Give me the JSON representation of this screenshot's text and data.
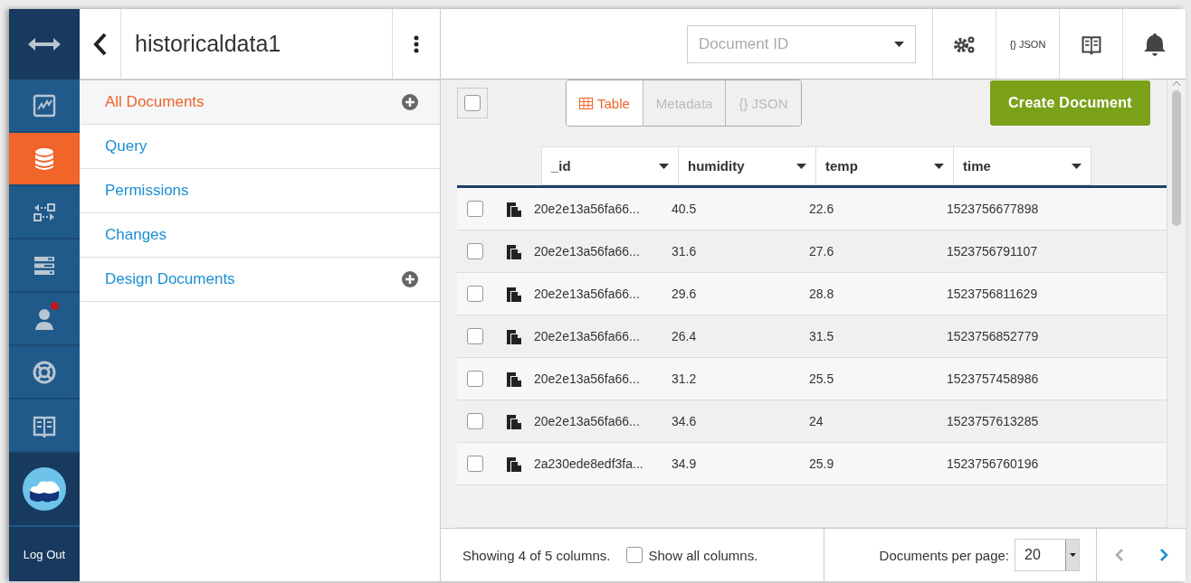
{
  "nav": {
    "items": [
      {
        "kind": "activity",
        "selected": false,
        "notification": false
      },
      {
        "kind": "database",
        "selected": true,
        "notification": false
      },
      {
        "kind": "replication",
        "selected": false,
        "notification": false
      },
      {
        "kind": "servers",
        "selected": false,
        "notification": false
      },
      {
        "kind": "user",
        "selected": false,
        "notification": true
      },
      {
        "kind": "support",
        "selected": false,
        "notification": false
      },
      {
        "kind": "docs",
        "selected": false,
        "notification": false
      }
    ],
    "logout": "Log Out"
  },
  "database": {
    "title": "historicaldata1"
  },
  "sidebar_items": [
    {
      "label": "All Documents",
      "selected": true,
      "addable": true
    },
    {
      "label": "Query",
      "selected": false,
      "addable": false
    },
    {
      "label": "Permissions",
      "selected": false,
      "addable": false
    },
    {
      "label": "Changes",
      "selected": false,
      "addable": false
    },
    {
      "label": "Design Documents",
      "selected": false,
      "addable": true
    }
  ],
  "header": {
    "document_id": {
      "placeholder": "Document ID"
    },
    "json_button": "{} JSON"
  },
  "select_all": {
    "checked": false
  },
  "view_tabs": [
    {
      "label": "Table",
      "selected": true
    },
    {
      "label": "Metadata",
      "selected": false
    },
    {
      "label": "{} JSON",
      "selected": false
    }
  ],
  "create_button": "Create Document",
  "table": {
    "columns": [
      "_id",
      "humidity",
      "temp",
      "time"
    ],
    "rows": [
      {
        "checked": false,
        "cells": [
          "20e2e13a56fa66...",
          "40.5",
          "22.6",
          "1523756677898"
        ]
      },
      {
        "checked": false,
        "cells": [
          "20e2e13a56fa66...",
          "31.6",
          "27.6",
          "1523756791107"
        ]
      },
      {
        "checked": false,
        "cells": [
          "20e2e13a56fa66...",
          "29.6",
          "28.8",
          "1523756811629"
        ]
      },
      {
        "checked": false,
        "cells": [
          "20e2e13a56fa66...",
          "26.4",
          "31.5",
          "1523756852779"
        ]
      },
      {
        "checked": false,
        "cells": [
          "20e2e13a56fa66...",
          "31.2",
          "25.5",
          "1523757458986"
        ]
      },
      {
        "checked": false,
        "cells": [
          "20e2e13a56fa66...",
          "34.6",
          "24",
          "1523757613285"
        ]
      },
      {
        "checked": false,
        "cells": [
          "2a230ede8edf3fa...",
          "34.9",
          "25.9",
          "1523756760196"
        ]
      }
    ]
  },
  "footer": {
    "status": "Showing 4 of 5 columns.",
    "show_all": {
      "label": "Show all columns.",
      "checked": false
    },
    "per_page_label": "Documents per page:",
    "per_page": "20",
    "prev": {
      "disabled": true
    },
    "next": {
      "disabled": false
    }
  }
}
